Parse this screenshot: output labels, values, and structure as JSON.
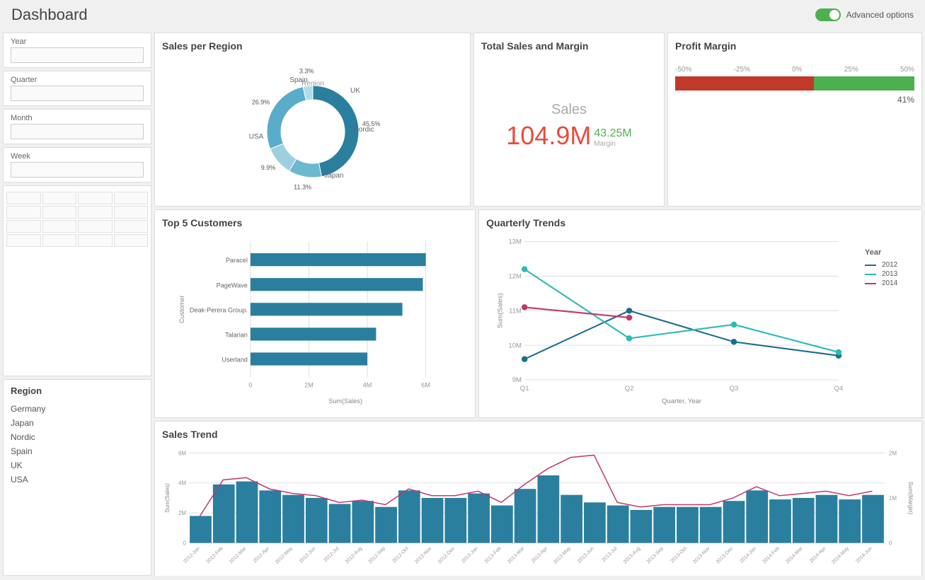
{
  "header": {
    "title": "Dashboard",
    "advanced_options_label": "Advanced options"
  },
  "sidebar": {
    "filters": [
      {
        "label": "Year",
        "value": ""
      },
      {
        "label": "Quarter",
        "value": ""
      },
      {
        "label": "Month",
        "value": ""
      },
      {
        "label": "Week",
        "value": ""
      }
    ],
    "region_title": "Region",
    "regions": [
      "Germany",
      "Japan",
      "Nordic",
      "Spain",
      "UK",
      "USA"
    ]
  },
  "sales_per_region": {
    "title": "Sales per Region",
    "donut": {
      "center_label": "Region",
      "segments": [
        {
          "label": "USA",
          "value": 45.5,
          "color": "#2a7f9e",
          "large": true
        },
        {
          "label": "Nordic",
          "value": 11.3,
          "color": "#6cb8d0"
        },
        {
          "label": "Japan",
          "value": 9.9,
          "color": "#9ecfe0"
        },
        {
          "label": "UK",
          "value": 26.9,
          "color": "#5aadca"
        },
        {
          "label": "Spain",
          "value": 3.3,
          "color": "#b0dcea"
        }
      ]
    }
  },
  "total_sales": {
    "title": "Total Sales and Margin",
    "sales_label": "Sales",
    "sales_value": "104.9M",
    "margin_value": "43.25M",
    "margin_label": "Margin"
  },
  "profit_margin": {
    "title": "Profit Margin",
    "axis_labels": [
      "-50%",
      "-25%",
      "0%",
      "25%",
      "50%"
    ],
    "red_width_pct": 58,
    "green_width_pct": 42,
    "value_label": "41%"
  },
  "top_customers": {
    "title": "Top 5 Customers",
    "x_axis_label": "Sum(Sales)",
    "y_axis_label": "Customer",
    "x_ticks": [
      "0",
      "2M",
      "4M",
      "6M"
    ],
    "bars": [
      {
        "label": "Paracel",
        "value": 6.0,
        "max": 6.5
      },
      {
        "label": "PageWave",
        "value": 5.9,
        "max": 6.5
      },
      {
        "label": "Deak-Perera Group.",
        "value": 5.2,
        "max": 6.5
      },
      {
        "label": "Talarian",
        "value": 4.3,
        "max": 6.5
      },
      {
        "label": "Userland",
        "value": 4.0,
        "max": 6.5
      }
    ]
  },
  "quarterly_trends": {
    "title": "Quarterly Trends",
    "y_label": "Sum(Sales)",
    "x_label": "Quarter, Year",
    "y_ticks": [
      "9M",
      "10M",
      "11M",
      "12M",
      "13M"
    ],
    "x_ticks": [
      "Q1",
      "Q2",
      "Q3",
      "Q4"
    ],
    "legend_title": "Year",
    "series": [
      {
        "year": "2012",
        "color": "#1a6e8e",
        "points": [
          9.6,
          11.0,
          10.1,
          9.7
        ]
      },
      {
        "year": "2013",
        "color": "#2abcb4",
        "points": [
          12.2,
          10.2,
          10.6,
          9.8
        ]
      },
      {
        "year": "2014",
        "color": "#c0396e",
        "points": [
          11.1,
          10.8,
          null,
          null
        ]
      }
    ]
  },
  "sales_trend": {
    "title": "Sales Trend",
    "y_left_label": "Sum(Sales)",
    "y_right_label": "Sum(Margin)",
    "y_left_ticks": [
      "0",
      "2M",
      "4M",
      "6M"
    ],
    "y_right_ticks": [
      "0",
      "1M",
      "2M"
    ],
    "x_labels": [
      "2012-Jan",
      "2012-Feb",
      "2012-Mar",
      "2012-Apr",
      "2012-May",
      "2012-Jun",
      "2012-Jul",
      "2012-Aug",
      "2012-Sep",
      "2012-Oct",
      "2012-Nov",
      "2012-Dec",
      "2013-Jan",
      "2013-Feb",
      "2013-Mar",
      "2013-Apr",
      "2013-May",
      "2013-Jun",
      "2013-Jul",
      "2013-Aug",
      "2013-Sep",
      "2013-Oct",
      "2013-Nov",
      "2013-Dec",
      "2014-Jan",
      "2014-Feb",
      "2014-Mar",
      "2014-Apr",
      "2014-May",
      "2014-Jun"
    ],
    "bar_color": "#2a7f9e",
    "line_color": "#c0396e",
    "bars": [
      1.8,
      3.9,
      4.1,
      3.5,
      3.2,
      3.0,
      2.6,
      2.8,
      2.4,
      3.5,
      3.0,
      3.0,
      3.3,
      2.5,
      3.6,
      4.5,
      3.2,
      2.7,
      2.5,
      2.2,
      2.4,
      2.4,
      2.4,
      2.8,
      3.5,
      2.9,
      3.0,
      3.2,
      2.9,
      3.2
    ],
    "line": [
      0.6,
      1.4,
      1.45,
      1.2,
      1.1,
      1.05,
      0.9,
      0.95,
      0.85,
      1.2,
      1.05,
      1.05,
      1.15,
      0.9,
      1.3,
      1.65,
      1.9,
      1.95,
      0.9,
      0.8,
      0.85,
      0.85,
      0.85,
      1.0,
      1.25,
      1.05,
      1.1,
      1.15,
      1.05,
      1.15
    ]
  }
}
